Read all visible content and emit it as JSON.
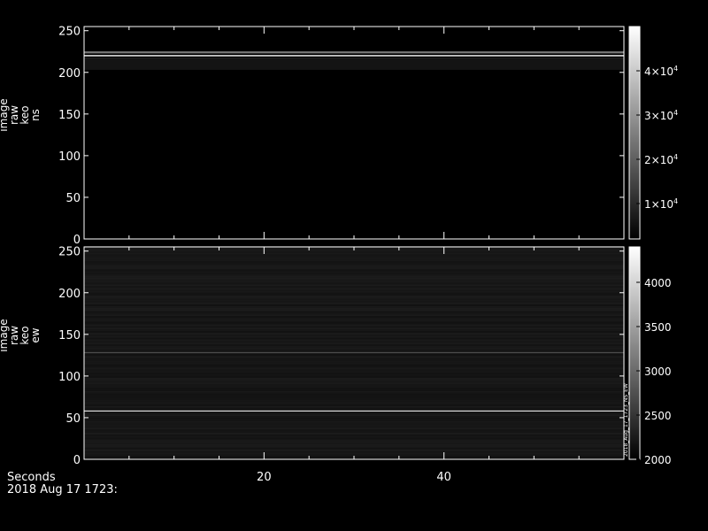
{
  "chart_data": [
    {
      "type": "heatmap",
      "ylabel_lines": [
        "image",
        "raw",
        "keo",
        "ns"
      ],
      "yticks": [
        0,
        50,
        100,
        150,
        200,
        250
      ],
      "ylim": [
        0,
        255
      ],
      "xlim": [
        0,
        60
      ],
      "bands": [
        {
          "y": 220,
          "intensity": 1.0,
          "width": 1.5
        },
        {
          "y": 224,
          "intensity": 0.45,
          "width": 2.5
        },
        {
          "y": 216,
          "intensity": 0.25,
          "width": 3
        },
        {
          "y": 210,
          "intensity": 0.08,
          "width": 14
        }
      ],
      "background": 0.0,
      "noise": 0.0,
      "colorbar": {
        "range": [
          2000,
          50000
        ],
        "ticks": [
          {
            "value": 10000,
            "label": "1×10",
            "exp": "4"
          },
          {
            "value": 20000,
            "label": "2×10",
            "exp": "4"
          },
          {
            "value": 30000,
            "label": "3×10",
            "exp": "4"
          },
          {
            "value": 40000,
            "label": "4×10",
            "exp": "4"
          }
        ]
      }
    },
    {
      "type": "heatmap",
      "ylabel_lines": [
        "image",
        "raw",
        "keo",
        "ew"
      ],
      "yticks": [
        0,
        50,
        100,
        150,
        200,
        250
      ],
      "ylim": [
        0,
        255
      ],
      "xlim": [
        0,
        60
      ],
      "bands": [
        {
          "y": 58,
          "intensity": 0.9,
          "width": 1.2
        },
        {
          "y": 128,
          "intensity": 0.3,
          "width": 1.2
        }
      ],
      "background": 0.07,
      "noise": 0.04,
      "colorbar": {
        "range": [
          2000,
          4400
        ],
        "ticks": [
          {
            "value": 2000,
            "label": "2000"
          },
          {
            "value": 2500,
            "label": "2500"
          },
          {
            "value": 3000,
            "label": "3000"
          },
          {
            "value": 3500,
            "label": "3500"
          },
          {
            "value": 4000,
            "label": "4000"
          }
        ]
      },
      "side_note": "2018_Aug_17_1723_NS_EW"
    }
  ],
  "xaxis": {
    "label": "Seconds",
    "ticks": [
      20,
      40
    ]
  },
  "footer": {
    "timestamp": "2018 Aug 17 1723:"
  }
}
